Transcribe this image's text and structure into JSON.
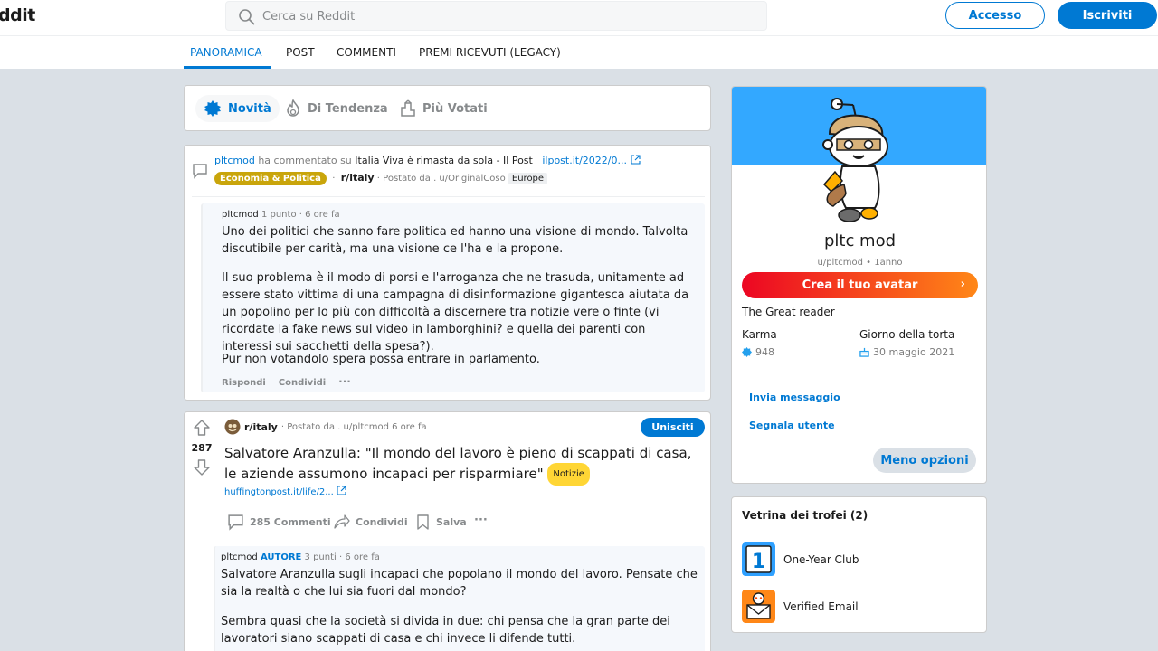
{
  "header": {
    "logo_text": "ddit",
    "search_placeholder": "Cerca su Reddit",
    "login_label": "Accesso",
    "signup_label": "Iscriviti"
  },
  "tabs": [
    {
      "label": "PANORAMICA",
      "active": true
    },
    {
      "label": "POST",
      "active": false
    },
    {
      "label": "COMMENTI",
      "active": false
    },
    {
      "label": "PREMI RICEVUTI (LEGACY)",
      "active": false
    }
  ],
  "sort": {
    "new_label": "Novità",
    "trending_label": "Di Tendenza",
    "top_label": "Più Votati"
  },
  "item1": {
    "user": "pltcmod",
    "action": "ha commentato su",
    "post_title": "Italia Viva è rimasta da sola - Il Post",
    "link": "ilpost.it/2022/0...",
    "flair": "Economia & Politica",
    "subreddit": "r/italy",
    "posted_by": "· Postato da . u/OriginalCoso",
    "chip": "Europe",
    "comment": {
      "author": "pltcmod",
      "points": "1 punto",
      "time": "· 6 ore fa",
      "p1": "Uno dei politici che sanno fare politica ed hanno una visione di mondo. Talvolta discutibile per carità, ma una visione ce l'ha e la propone.",
      "p2": "Il suo problema è il modo di porsi e l'arroganza che ne trasuda, unitamente ad essere stato vittima di una campagna di disinformazione gigantesca aiutata da un popolino per lo più con difficoltà a discernere tra notizie vere o finte (vi ricordate la fake news sul video in lamborghini? e quella dei parenti con interessi sui sacchetti della spesa?).",
      "p3": "Pur non votandolo spera possa entrare in parlamento.",
      "reply": "Rispondi",
      "share": "Condividi",
      "more": "···"
    }
  },
  "item2": {
    "subreddit": "r/italy",
    "posted_by": "· Postato da . u/pltcmod 6 ore fa",
    "join_label": "Unisciti",
    "votes": "287",
    "title": "Salvatore Aranzulla: \"Il mondo del lavoro è pieno di scappati di casa, le aziende assumono incapaci per risparmiare\"",
    "flair": "Notizie",
    "link": "huffingtonpost.it/life/2...",
    "comments_label": "285 Commenti",
    "share_label": "Condividi",
    "save_label": "Salva",
    "more": "···",
    "comment": {
      "author": "pltcmod",
      "badge": "AUTORE",
      "points": "3 punti",
      "time": "· 6 ore fa",
      "p1": "Salvatore Aranzulla sugli incapaci che popolano il mondo del lavoro. Pensate che sia la realtà o che lui sia fuori dal mondo?",
      "p2": "Sembra quasi che la società si divida in due: chi pensa che la gran parte dei lavoratori siano scappati di casa e chi invece li difende tutti."
    }
  },
  "profile": {
    "display_name": "pltc mod",
    "username_age": "u/pltcmod • 1anno",
    "avatar_button": "Crea il tuo avatar",
    "description": "The Great reader",
    "karma_label": "Karma",
    "karma_value": "948",
    "cake_label": "Giorno della torta",
    "cake_value": "30 maggio 2021",
    "send_message": "Invia messaggio",
    "report_user": "Segnala utente",
    "less_options": "Meno opzioni",
    "banner_color": "#33a8ff"
  },
  "trophies": {
    "title": "Vetrina dei trofei (2)",
    "items": [
      {
        "name": "One-Year Club"
      },
      {
        "name": "Verified Email"
      }
    ]
  },
  "colors": {
    "accent": "#0079d3",
    "background": "#dae0e6"
  }
}
